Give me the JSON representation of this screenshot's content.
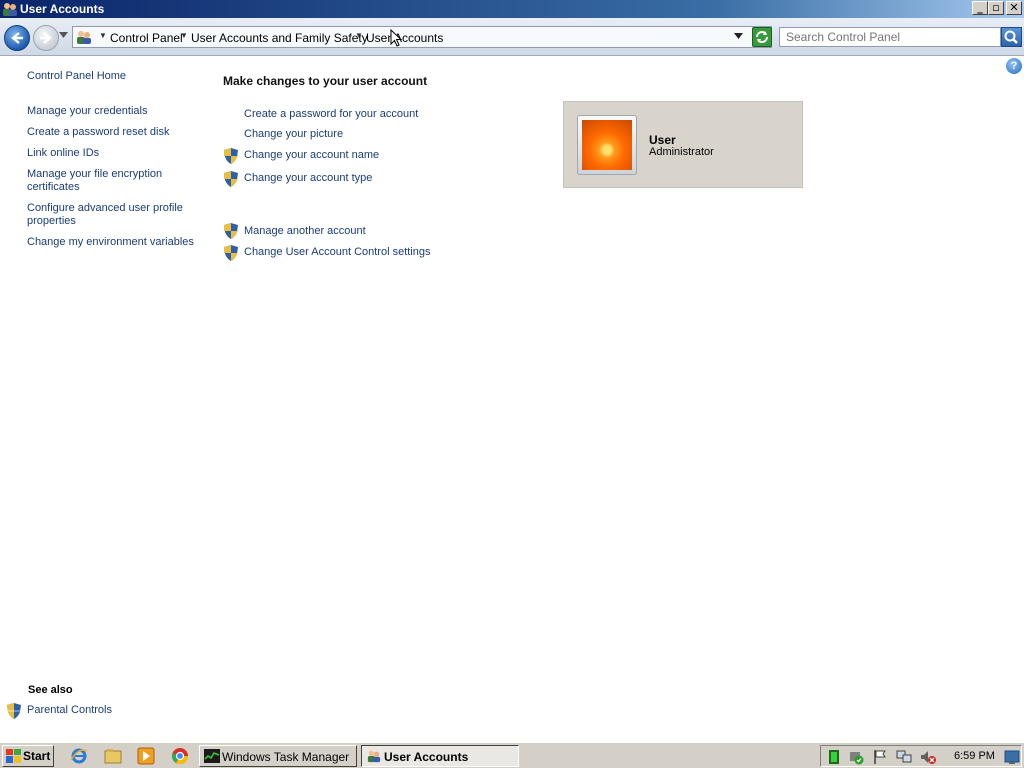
{
  "window": {
    "title": "User Accounts"
  },
  "address": {
    "crumbs": [
      "Control Panel",
      "User Accounts and Family Safety",
      "User Accounts"
    ],
    "search_placeholder": "Search Control Panel"
  },
  "left": {
    "home": "Control Panel Home",
    "links": [
      "Manage your credentials",
      "Create a password reset disk",
      "Link online IDs",
      "Manage your file encryption certificates",
      "Configure advanced user profile properties",
      "Change my environment variables"
    ],
    "see_also_title": "See also",
    "see_also": [
      "Parental Controls"
    ]
  },
  "main": {
    "title": "Make changes to your user account",
    "tasks": [
      "Create a password for your account",
      "Change your picture",
      "Change your account name",
      "Change your account type"
    ],
    "other_tasks": [
      "Manage another account",
      "Change User Account Control settings"
    ]
  },
  "account": {
    "name": "User",
    "type": "Administrator"
  },
  "taskbar": {
    "start": "Start",
    "buttons": [
      "Windows Task Manager",
      "User Accounts"
    ],
    "clock": "6:59 PM"
  },
  "icons": {
    "app": "user-accounts-icon",
    "shield": "uac-shield-icon"
  },
  "colors": {
    "link": "#1a3c78",
    "titlebar": "#0a246a"
  }
}
